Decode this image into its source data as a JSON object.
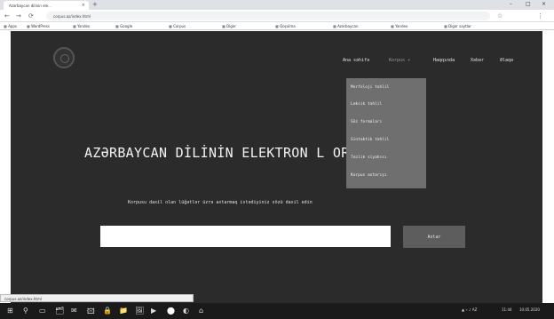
{
  "browser": {
    "tab_title": "Azərbaycan dilinin ele...",
    "tab_close": "×",
    "new_tab": "+",
    "window_controls": [
      "–",
      "□",
      "×"
    ],
    "url": "corpus.az/index.html",
    "nav": {
      "back": "←",
      "forward": "→",
      "reload": "⟳"
    },
    "toolbar_icons": [
      "☆",
      "⋮"
    ],
    "bookmarks": [
      "Apps",
      "WordPress",
      "Yandex",
      "Google",
      "Corpus",
      "Digər",
      "Qoşulma",
      "Azərbaycan",
      "Yandex",
      "Digər saytlar"
    ]
  },
  "site": {
    "nav": {
      "home": "Ana səhifə",
      "corpus": "Korpus ▾",
      "about": "Haqqında",
      "news": "Xəbər",
      "contact": "Əlaqə"
    },
    "dropdown": [
      "Morfoloji təhlil",
      "Leksik təhlil",
      "Söz formaları",
      "Sintaktik təhlil",
      "Tezlik siyahısı",
      "Korpus axtarışı"
    ],
    "title": "AZƏRBAYCAN DİLİNİN ELEKTRON L        ORPUSU",
    "subtitle": "Korpusu daxil olan lüğətlər üzrə axtarmaq istədiyiniz sözü daxil edin",
    "search": {
      "placeholder": "",
      "button": "Axtar"
    }
  },
  "status_bar": "corpus.az/index.html",
  "taskbar": {
    "icons": [
      "⊞",
      "⚲",
      "▭",
      "🗂",
      "✉",
      "🖾",
      "🔒",
      "📁",
      "🖼",
      "▶",
      "⬤",
      "◐",
      "⌂"
    ],
    "tray_time": "11:44",
    "tray_date": "10.05.2020",
    "tray_icons": "▲ ⌁ ♪ AZ"
  }
}
